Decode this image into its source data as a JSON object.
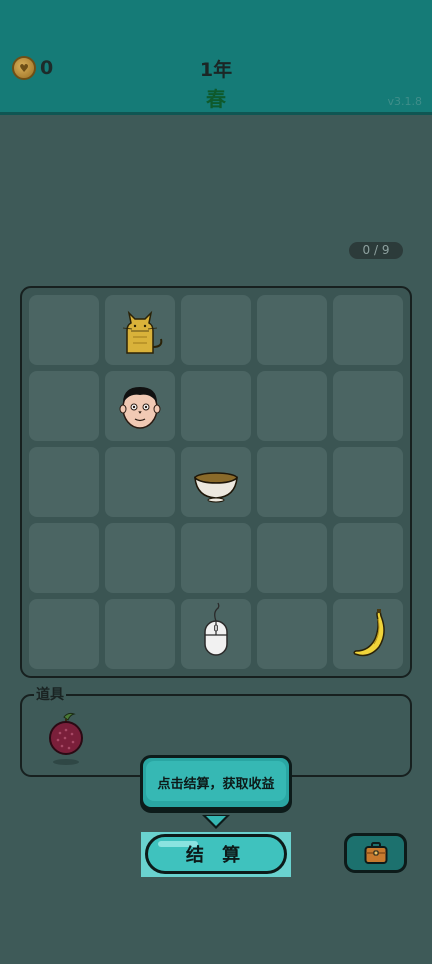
{
  "header": {
    "coins": "0",
    "year": "1年",
    "season": "春",
    "version": "v3.1.8"
  },
  "progress": "0 / 9",
  "grid": {
    "rows": 5,
    "cols": 5,
    "items": [
      {
        "row": 0,
        "col": 1,
        "icon": "cat-icon"
      },
      {
        "row": 1,
        "col": 1,
        "icon": "face-icon"
      },
      {
        "row": 2,
        "col": 2,
        "icon": "soup-bowl-icon"
      },
      {
        "row": 4,
        "col": 2,
        "icon": "mouse-icon"
      },
      {
        "row": 4,
        "col": 4,
        "icon": "banana-icon"
      }
    ]
  },
  "props": {
    "label": "道具",
    "items": [
      {
        "icon": "lychee-icon"
      }
    ]
  },
  "tooltip": "点击结算，获取收益",
  "settle_button": "结 算",
  "bag_button": {
    "icon": "briefcase-icon"
  },
  "colors": {
    "header": "#157b77",
    "background": "#3e5a58",
    "cell": "#4b6563",
    "accent": "#3fc2be",
    "season": "#0e5a2c"
  }
}
